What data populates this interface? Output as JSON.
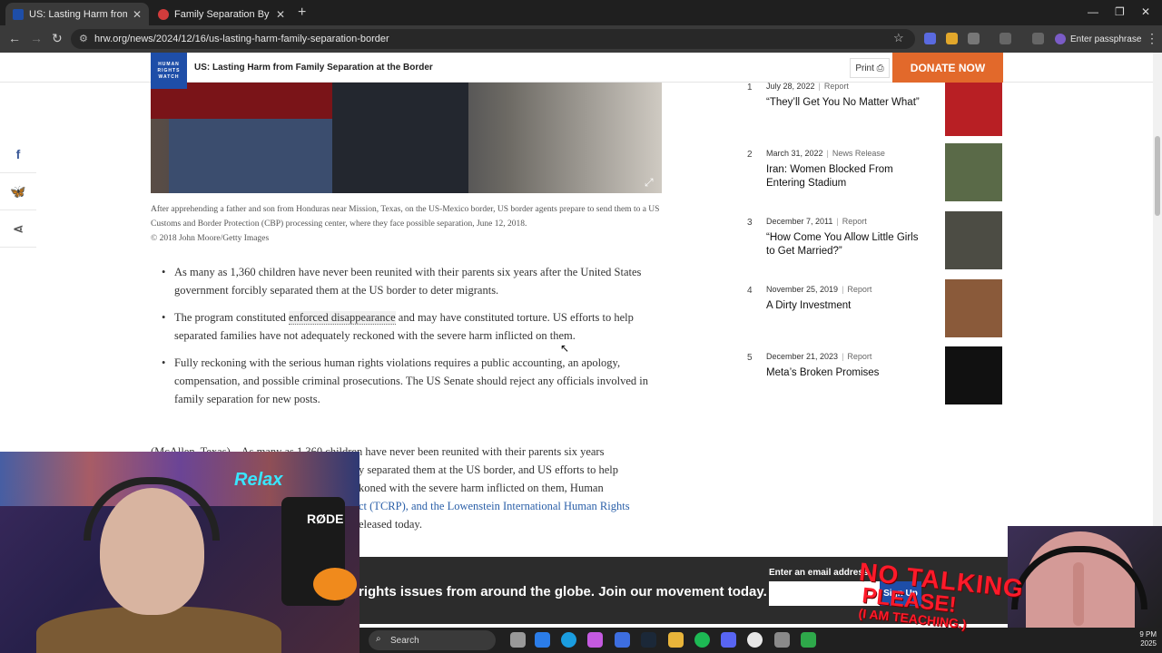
{
  "browser": {
    "tabs": [
      {
        "title": "US: Lasting Harm from Family S",
        "active": true,
        "favicon_color": "#1e4ea8"
      },
      {
        "title": "Family Separation By the Numb",
        "active": false,
        "favicon_color": "#d23c3c"
      }
    ],
    "url": "hrw.org/news/2024/12/16/us-lasting-harm-family-separation-border",
    "profile_label": "Enter passphrase"
  },
  "site": {
    "logo_lines": [
      "HUMAN",
      "RIGHTS",
      "WATCH"
    ],
    "header_title": "US: Lasting Harm from Family Separation at the Border",
    "print_label": "Print",
    "donate_label": "DONATE NOW"
  },
  "article": {
    "caption": "After apprehending a father and son from Honduras near Mission, Texas, on the US-Mexico border, US border agents prepare to send them to a US Customs and Border Protection (CBP) processing center, where they face possible separation, June 12, 2018.",
    "credit": "© 2018 John Moore/Getty Images",
    "bullets": [
      "As many as 1,360 children have never been reunited with their parents six years after the United States government forcibly separated them at the US border to deter migrants.",
      "The program constituted",
      "enforced disappearance",
      "and may have constituted torture. US efforts to help separated families have not adequately reckoned with the severe harm inflicted on them.",
      "Fully reckoning with the serious human rights violations requires a public accounting, an apology, compensation, and possible criminal prosecutions. The US Senate should reject any officials involved in family separation for new posts."
    ],
    "para_lines": [
      "(McAllen, Texas) – As many as 1,360 children have never been reunited with their parents six years",
      "y separated them at the US border, and US efforts to help",
      "koned with the severe harm inflicted on them, Human",
      "ct (TCRP), and the",
      "Lowenstein International Human Rights",
      "eleased today."
    ]
  },
  "sidebar": {
    "items": [
      {
        "num": "1",
        "date": "July 28, 2022",
        "kind": "Report",
        "title": "“They’ll Get You No Matter What”",
        "thumb": "#b81f24"
      },
      {
        "num": "2",
        "date": "March 31, 2022",
        "kind": "News Release",
        "title": "Iran: Women Blocked From Entering Stadium",
        "thumb": "#5a6a48"
      },
      {
        "num": "3",
        "date": "December 7, 2011",
        "kind": "Report",
        "title": "“How Come You Allow Little Girls to Get Married?”",
        "thumb": "#4c4c44"
      },
      {
        "num": "4",
        "date": "November 25, 2019",
        "kind": "Report",
        "title": "A Dirty Investment",
        "thumb": "#8a5a3a"
      },
      {
        "num": "5",
        "date": "December 21, 2023",
        "kind": "Report",
        "title": "Meta’s Broken Promises",
        "thumb": "#111111"
      }
    ]
  },
  "newsletter": {
    "message": "rights issues from around the globe. Join our movement today.",
    "email_label": "Enter an email address",
    "signup_label": "Sign Up"
  },
  "taskbar": {
    "search_label": "Search",
    "clock_time": "9 PM",
    "clock_date": "2025"
  },
  "overlay": {
    "cam_sign": "Relax",
    "mic_brand": "RØDE",
    "sign_line1": "NO TALKING",
    "sign_line2": "PLEASE!",
    "sign_line3": "(I AM TEACHING.)"
  }
}
